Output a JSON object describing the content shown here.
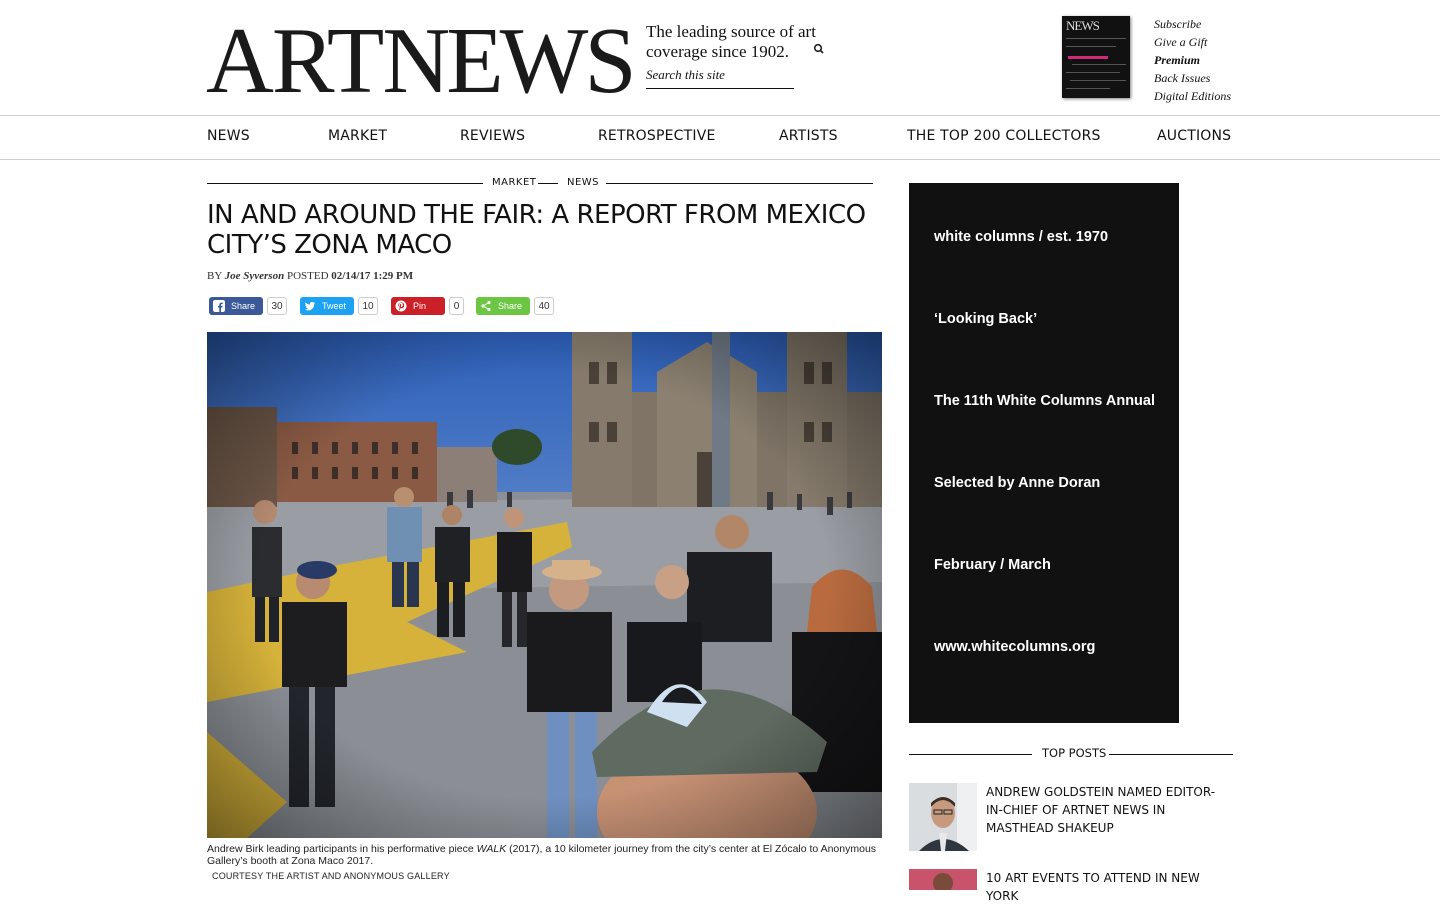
{
  "header": {
    "logo_art": "ART",
    "logo_news": "NEWS",
    "tagline": "The leading source of art coverage since 1902.",
    "search_placeholder": "Search this site",
    "magazine_links": [
      {
        "label": "Subscribe"
      },
      {
        "label": "Give a Gift"
      },
      {
        "label": "Premium"
      },
      {
        "label": "Back Issues"
      },
      {
        "label": "Digital Editions"
      }
    ]
  },
  "nav": {
    "items": [
      {
        "label": "NEWS"
      },
      {
        "label": "MARKET"
      },
      {
        "label": "REVIEWS"
      },
      {
        "label": "RETROSPECTIVE"
      },
      {
        "label": "ARTISTS"
      },
      {
        "label": "THE TOP 200 COLLECTORS"
      },
      {
        "label": "AUCTIONS"
      }
    ]
  },
  "article": {
    "categories": [
      "MARKET",
      "NEWS"
    ],
    "title": "IN AND AROUND THE FAIR: A REPORT FROM MEXICO CITY’S ZONA MACO",
    "by_label": "BY",
    "author": "Joe Syverson",
    "posted_label": "POSTED",
    "date": "02/14/17 1:29 PM",
    "share": [
      {
        "label": "Share",
        "count": "30",
        "color": "#3b5998",
        "icon": "facebook-icon"
      },
      {
        "label": "Tweet",
        "count": "10",
        "color": "#1da1f2",
        "icon": "twitter-icon"
      },
      {
        "label": "Pin",
        "count": "0",
        "color": "#cb2027",
        "icon": "pinterest-icon"
      },
      {
        "label": "Share",
        "count": "40",
        "color": "#6cc644",
        "icon": "share-icon"
      }
    ],
    "caption_pre": "Andrew Birk leading participants in his performative piece ",
    "caption_work": "WALK",
    "caption_post": " (2017), a 10 kilometer journey from the city’s center at El Zócalo to Anonymous Gallery’s booth at Zona Maco 2017.",
    "credit": "COURTESY THE ARTIST AND ANONYMOUS GALLERY"
  },
  "ad": {
    "lines": [
      "white columns / est. 1970",
      "‘Looking Back’",
      "The 11th White Columns Annual",
      "Selected by Anne Doran",
      "February / March",
      "www.whitecolumns.org"
    ]
  },
  "top_posts": {
    "label": "TOP POSTS",
    "items": [
      {
        "title": "ANDREW GOLDSTEIN NAMED EDITOR-IN-CHIEF OF ARTNET NEWS IN MASTHEAD SHAKEUP"
      },
      {
        "title": "10 ART EVENTS TO ATTEND IN NEW YORK"
      }
    ]
  }
}
